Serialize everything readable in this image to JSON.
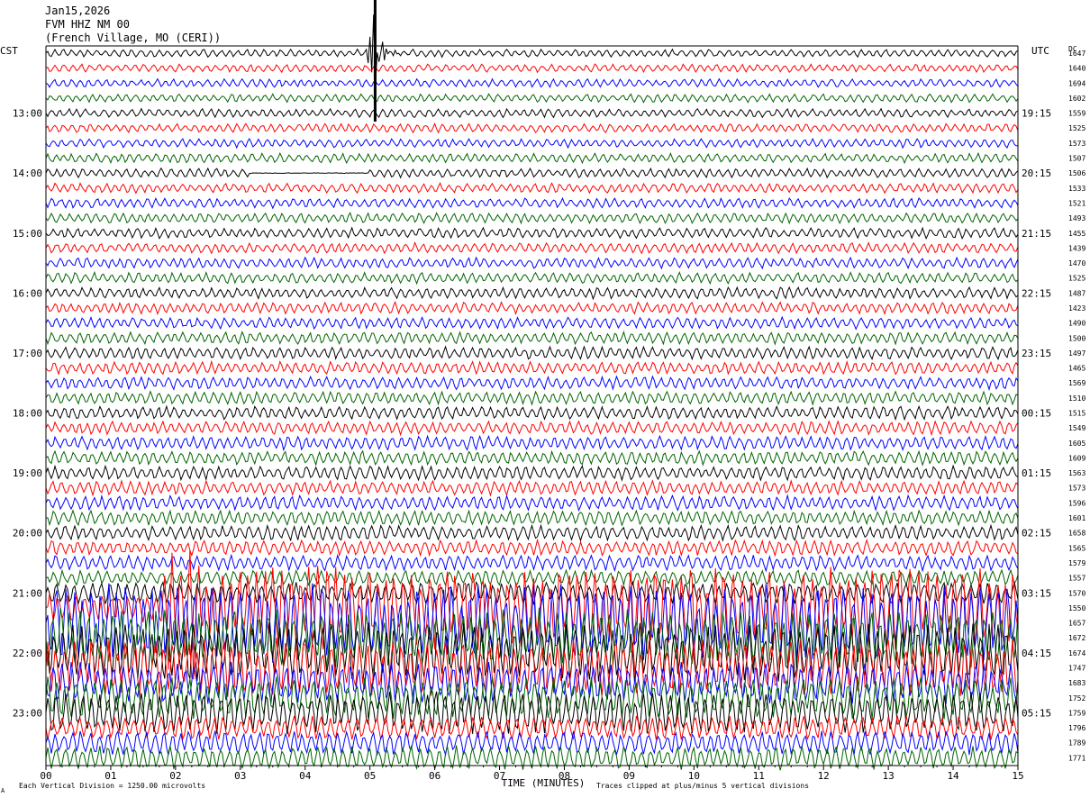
{
  "header": {
    "date": "Jan15,2026",
    "station": "FVM HHZ NM 00",
    "location": "(French Village, MO (CERI))"
  },
  "left_label": "CST",
  "right_label": "UTC",
  "dc_label": "DC",
  "colors": [
    "#000000",
    "#ff0000",
    "#0000ff",
    "#006400"
  ],
  "footer": {
    "scale_note": "Each Vertical Division = 1250.00 microvolts",
    "clip_note": "Traces clipped at plus/minus 5 vertical divisions",
    "corner_mark": "A"
  },
  "chart_data": {
    "type": "line",
    "xlabel": "TIME (MINUTES)",
    "x_ticks": [
      "00",
      "01",
      "02",
      "03",
      "04",
      "05",
      "06",
      "07",
      "08",
      "09",
      "10",
      "11",
      "12",
      "13",
      "14",
      "15"
    ],
    "xlim": [
      0,
      15
    ],
    "trace_count": 48,
    "minutes_per_trace": 15,
    "left_time_labels": [
      "13:00",
      "14:00",
      "15:00",
      "16:00",
      "17:00",
      "18:00",
      "19:00",
      "20:00",
      "21:00",
      "22:00",
      "23:00"
    ],
    "right_time_labels": [
      "19:15",
      "20:15",
      "21:15",
      "22:15",
      "23:15",
      "00:15",
      "01:15",
      "02:15",
      "03:15",
      "04:15",
      "05:15"
    ],
    "dc_offsets": [
      1647,
      1640,
      1694,
      1602,
      1559,
      1525,
      1573,
      1507,
      1506,
      1533,
      1521,
      1493,
      1455,
      1439,
      1470,
      1525,
      1487,
      1423,
      1490,
      1500,
      1497,
      1465,
      1569,
      1510,
      1515,
      1549,
      1605,
      1609,
      1563,
      1573,
      1596,
      1601,
      1658,
      1565,
      1579,
      1557,
      1570,
      1550,
      1657,
      1672,
      1674,
      1747,
      1683,
      1752,
      1759,
      1796,
      1789,
      1771
    ],
    "events": [
      {
        "trace": 0,
        "minute": 5.05,
        "type": "local-spike"
      },
      {
        "trace": 37,
        "minute": 1.9,
        "type": "teleseism-onset"
      }
    ]
  }
}
